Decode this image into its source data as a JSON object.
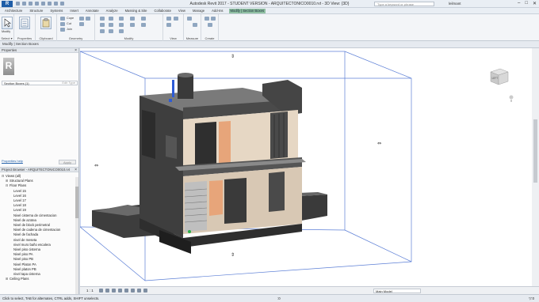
{
  "titlebar": {
    "app_letter": "R",
    "title": "Autodesk Revit 2017 - STUDENT VERSION - ARQUITECTONICO0010.rvt - 3D View: {3D}",
    "search_placeholder": "Type a keyword or phrase",
    "user": "leilmant",
    "min": "–",
    "max": "□",
    "close": "✕"
  },
  "tabs": [
    "Architecture",
    "Structure",
    "Systems",
    "Insert",
    "Annotate",
    "Analyze",
    "Massing & Site",
    "Collaborate",
    "View",
    "Manage",
    "Add-Ins",
    "Modify | Section Boxes"
  ],
  "ribbon": {
    "modify": "Modify",
    "select": "Select ▾",
    "properties": "Properties",
    "clipboard": "Clipboard",
    "cope": "Cope",
    "cut": "Cut",
    "join": "Join",
    "geometry": "Geometry",
    "modify_group": "Modify",
    "view": "View",
    "measure": "Measure",
    "create": "Create"
  },
  "context_bar": "Modify | Section Boxes",
  "properties": {
    "header": "Properties",
    "type_letter": "R",
    "type_selector": "Section Boxes (1)",
    "edit_type": "Edit Type",
    "help_link": "Properties help",
    "apply": "Apply"
  },
  "project_browser": {
    "header": "Project Browser - ARQUITECTONICO0010.rvt",
    "items": [
      {
        "label": "Views (all)",
        "indent": 0,
        "tw": "⊟"
      },
      {
        "label": "Structural Plans",
        "indent": 1,
        "tw": "⊞"
      },
      {
        "label": "Floor Plans",
        "indent": 1,
        "tw": "⊟"
      },
      {
        "label": "Level 15",
        "indent": 2,
        "tw": ""
      },
      {
        "label": "Level 16",
        "indent": 2,
        "tw": ""
      },
      {
        "label": "Level 17",
        "indent": 2,
        "tw": ""
      },
      {
        "label": "Level 18",
        "indent": 2,
        "tw": ""
      },
      {
        "label": "Level 19",
        "indent": 2,
        "tw": ""
      },
      {
        "label": "Nivel cisterna de cimentacion",
        "indent": 2,
        "tw": ""
      },
      {
        "label": "Nivel de azotea",
        "indent": 2,
        "tw": ""
      },
      {
        "label": "Nivel de block perimetral",
        "indent": 2,
        "tw": ""
      },
      {
        "label": "Nivel de cadena de cimentacion",
        "indent": 2,
        "tw": ""
      },
      {
        "label": "Nivel de fachada",
        "indent": 2,
        "tw": ""
      },
      {
        "label": "nivel de meseta",
        "indent": 2,
        "tw": ""
      },
      {
        "label": "nivel muro baño escalera",
        "indent": 2,
        "tw": ""
      },
      {
        "label": "Nivel piso cisterna",
        "indent": 2,
        "tw": ""
      },
      {
        "label": "Nivel piso PA",
        "indent": 2,
        "tw": ""
      },
      {
        "label": "Nivel piso PB",
        "indent": 2,
        "tw": ""
      },
      {
        "label": "Nivel Platon PA",
        "indent": 2,
        "tw": ""
      },
      {
        "label": "Nivel platon PB",
        "indent": 2,
        "tw": ""
      },
      {
        "label": "nivel tapa cisterna",
        "indent": 2,
        "tw": ""
      },
      {
        "label": "Ceiling Plans",
        "indent": 1,
        "tw": "⊞"
      }
    ]
  },
  "viewcube": {
    "face": "LEFT"
  },
  "viewbar": {
    "scale": "1 : 1",
    "model": "Main Model"
  },
  "statusbar": {
    "text": "Click to select, TAB for alternates, CTRL adds, SHIFT unselects.",
    "zero": ":0",
    "filter": "▽:0"
  }
}
